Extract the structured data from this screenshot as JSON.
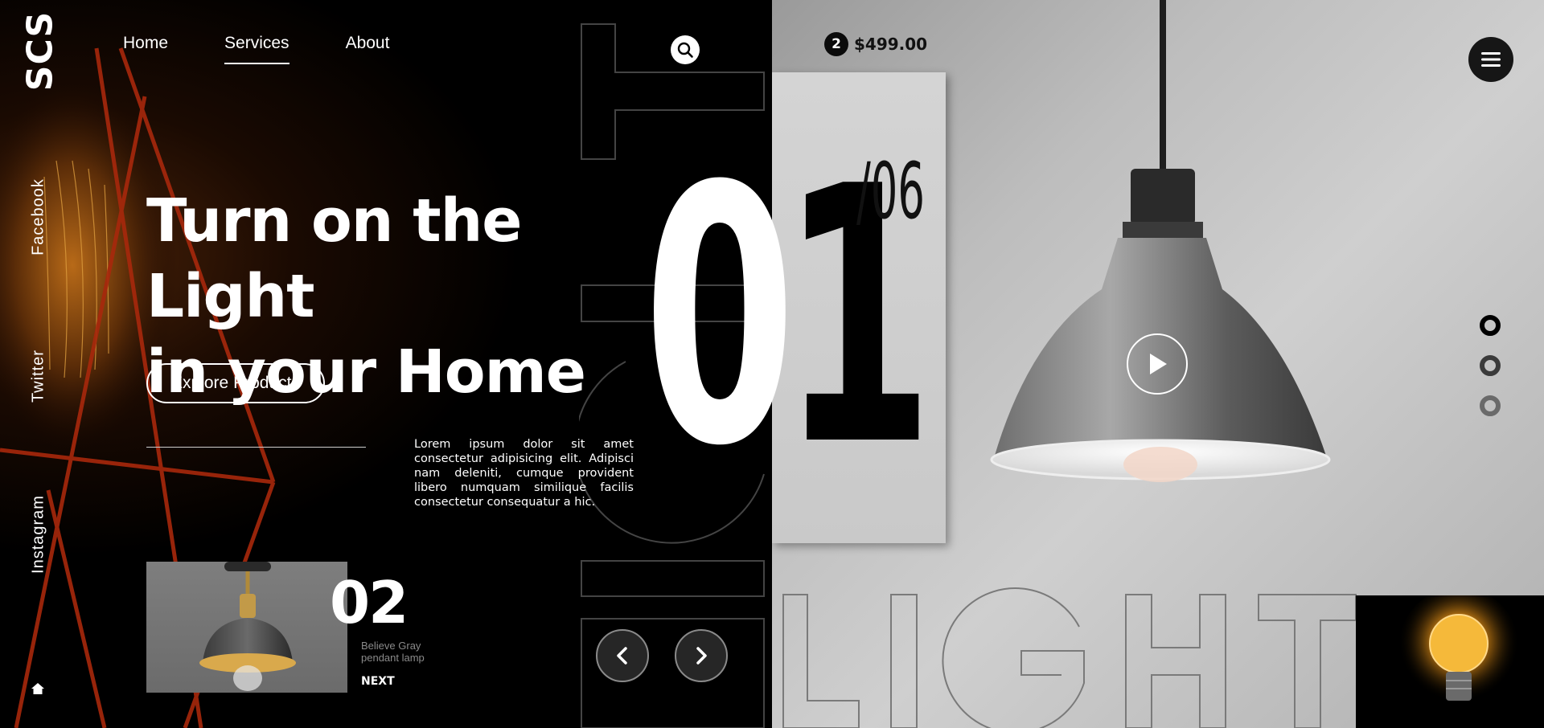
{
  "brand": {
    "logo": "SCS"
  },
  "nav": {
    "items": [
      "Home",
      "Services",
      "About"
    ],
    "active": 1
  },
  "social": [
    "Facebook",
    "Twitter",
    "Instagram"
  ],
  "cart": {
    "count": "2",
    "total": "$499.00"
  },
  "hero": {
    "title_line1": "Turn on the Light",
    "title_line2": "in your Home",
    "cta_label": "Explore Products",
    "description": "Lorem ipsum dolor sit amet consectetur adipisicing elit. Adipisci nam deleniti, cumque provident libero numquam similique facilis consectetur consequatur a hic.",
    "background_word": "LIGHT"
  },
  "slider": {
    "current_first": "0",
    "current_second": "1",
    "total": "/06",
    "next_number": "02",
    "next_caption": "Believe Gray pendant lamp",
    "next_label": "NEXT",
    "dots": 3,
    "active_dot": 0
  },
  "icons": {
    "search": "search-icon",
    "menu": "hamburger-menu-icon",
    "home": "home-icon",
    "play": "play-icon",
    "prev": "chevron-left-icon",
    "next": "chevron-right-icon"
  },
  "colors": {
    "accent_glow": "#f0a020",
    "dark": "#000000",
    "light": "#ffffff"
  }
}
